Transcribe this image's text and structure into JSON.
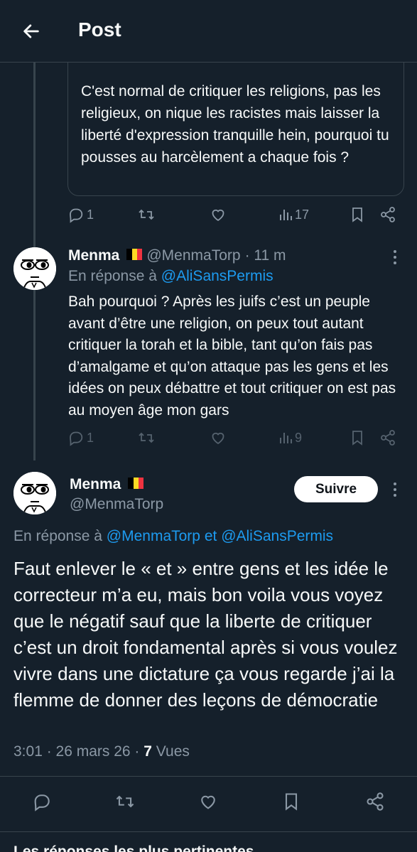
{
  "header": {
    "title": "Post"
  },
  "quoted": {
    "text": "C'est normal de critiquer les religions, pas les religieux, on nique les racistes mais laisser la liberté d'expression tranquille hein, pourquoi tu pousses au harcèlement a chaque fois ?",
    "actions": {
      "replies": "1",
      "views": "17"
    }
  },
  "reply": {
    "name": "Menma",
    "handle": "@MenmaTorp",
    "time": "· 11 m",
    "reply_prefix": "En réponse à",
    "reply_to": "@AliSansPermis",
    "text": "Bah pourquoi ? Après les juifs c’est un peuple avant d’être une religion, on peux tout autant critiquer la torah et la bible, tant qu’on fais pas d’amalgame et qu’on attaque pas les gens et les idées on peux débattre et tout critiquer on est pas au moyen âge mon gars",
    "actions": {
      "replies": "1",
      "views": "9"
    }
  },
  "main_tweet": {
    "name": "Menma",
    "handle": "@MenmaTorp",
    "follow_label": "Suivre",
    "reply_prefix": "En réponse à",
    "reply_to_1": "@MenmaTorp",
    "reply_and": "et",
    "reply_to_2": "@AliSansPermis",
    "text": "Faut enlever le « et » entre gens et les idée le correcteur m’a eu, mais bon voila vous voyez que le négatif sauf que la liberte de critiquer c’est un droit fondamental après si vous voulez vivre dans une dictature ça vous regarde j’ai la flemme de donner des leçons de démocratie",
    "time": "3:01 · 26 mars 26 ·",
    "views_count": "7",
    "views_label": "Vues"
  },
  "next_section": "Les réponses les plus pertinentes ⌄",
  "colors": {
    "background": "#15202b",
    "text": "#f7f9f9",
    "muted": "#8b98a5",
    "link": "#1d9bf0",
    "border": "#38444d"
  },
  "icons": [
    "back-arrow-icon",
    "reply-icon",
    "retweet-icon",
    "like-icon",
    "views-icon",
    "bookmark-icon",
    "share-icon",
    "more-icon",
    "belgium-flag-icon"
  ]
}
